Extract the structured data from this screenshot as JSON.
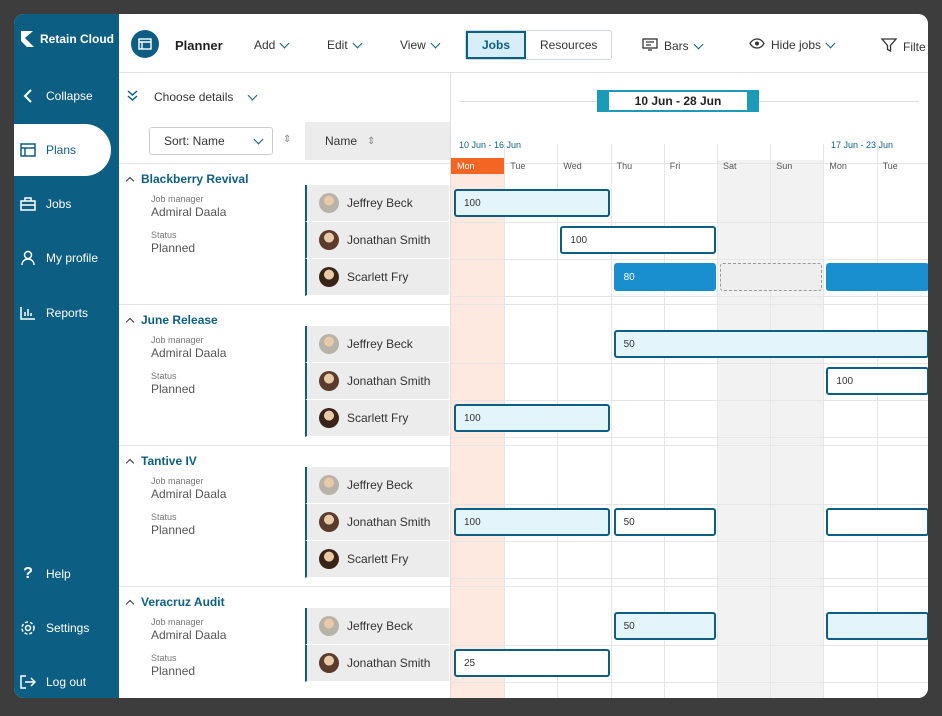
{
  "app": {
    "brand": "Retain Cloud",
    "page_title": "Planner"
  },
  "sidebar": {
    "collapse_label": "Collapse",
    "items": [
      {
        "label": "Plans",
        "icon": "plans-icon",
        "active": true
      },
      {
        "label": "Jobs",
        "icon": "briefcase-icon"
      },
      {
        "label": "My profile",
        "icon": "user-icon"
      },
      {
        "label": "Reports",
        "icon": "chart-icon"
      }
    ],
    "bottom": [
      {
        "label": "Help",
        "icon": "help-icon"
      },
      {
        "label": "Settings",
        "icon": "gear-icon"
      },
      {
        "label": "Log out",
        "icon": "logout-icon"
      }
    ]
  },
  "toolbar": {
    "add": "Add",
    "edit": "Edit",
    "view": "View",
    "jobs_tab": "Jobs",
    "resources_tab": "Resources",
    "bars": "Bars",
    "hide_jobs": "Hide jobs",
    "filter": "Filte"
  },
  "left_header": {
    "choose_details": "Choose details",
    "sort": "Sort: Name",
    "name_col": "Name"
  },
  "date_range": {
    "label": "10 Jun - 28 Jun",
    "week1": "10 Jun - 16 Jun",
    "week2": "17 Jun - 23 Jun"
  },
  "days": [
    "Mon",
    "Tue",
    "Wed",
    "Thu",
    "Fri",
    "Sat",
    "Sun",
    "Mon",
    "Tue"
  ],
  "labels": {
    "job_manager": "Job manager",
    "status": "Status"
  },
  "projects": [
    {
      "title": "Blackberry Revival",
      "manager": "Admiral Daala",
      "status": "Planned",
      "people": [
        "Jeffrey Beck",
        "Jonathan Smith",
        "Scarlett Fry"
      ],
      "bars": [
        {
          "row": 0,
          "start": 0,
          "span": 3,
          "label": "100",
          "style": "light"
        },
        {
          "row": 1,
          "start": 2,
          "span": 3,
          "label": "100",
          "style": "white"
        },
        {
          "row": 2,
          "start": 3,
          "span": 2,
          "label": "80",
          "style": "dark"
        },
        {
          "row": 2,
          "start": 5,
          "span": 2,
          "label": "",
          "style": "dash"
        },
        {
          "row": 2,
          "start": 7,
          "span": 2,
          "label": "",
          "style": "dark"
        }
      ]
    },
    {
      "title": "June Release",
      "manager": "Admiral Daala",
      "status": "Planned",
      "people": [
        "Jeffrey Beck",
        "Jonathan Smith",
        "Scarlett Fry"
      ],
      "bars": [
        {
          "row": 0,
          "start": 3,
          "span": 6,
          "label": "50",
          "style": "light"
        },
        {
          "row": 1,
          "start": 7,
          "span": 2,
          "label": "100",
          "style": "white"
        },
        {
          "row": 2,
          "start": 0,
          "span": 3,
          "label": "100",
          "style": "light"
        }
      ]
    },
    {
      "title": "Tantive IV",
      "manager": "Admiral Daala",
      "status": "Planned",
      "people": [
        "Jeffrey Beck",
        "Jonathan Smith",
        "Scarlett Fry"
      ],
      "bars": [
        {
          "row": 1,
          "start": 0,
          "span": 3,
          "label": "100",
          "style": "light"
        },
        {
          "row": 1,
          "start": 3,
          "span": 2,
          "label": "50",
          "style": "white"
        },
        {
          "row": 1,
          "start": 7,
          "span": 2,
          "label": "",
          "style": "white"
        }
      ]
    },
    {
      "title": "Veracruz Audit",
      "manager": "Admiral Daala",
      "status": "Planned",
      "people": [
        "Jeffrey Beck",
        "Jonathan Smith"
      ],
      "bars": [
        {
          "row": 0,
          "start": 3,
          "span": 2,
          "label": "50",
          "style": "light"
        },
        {
          "row": 0,
          "start": 7,
          "span": 2,
          "label": "",
          "style": "light"
        },
        {
          "row": 1,
          "start": 0,
          "span": 3,
          "label": "25",
          "style": "white"
        }
      ]
    }
  ]
}
